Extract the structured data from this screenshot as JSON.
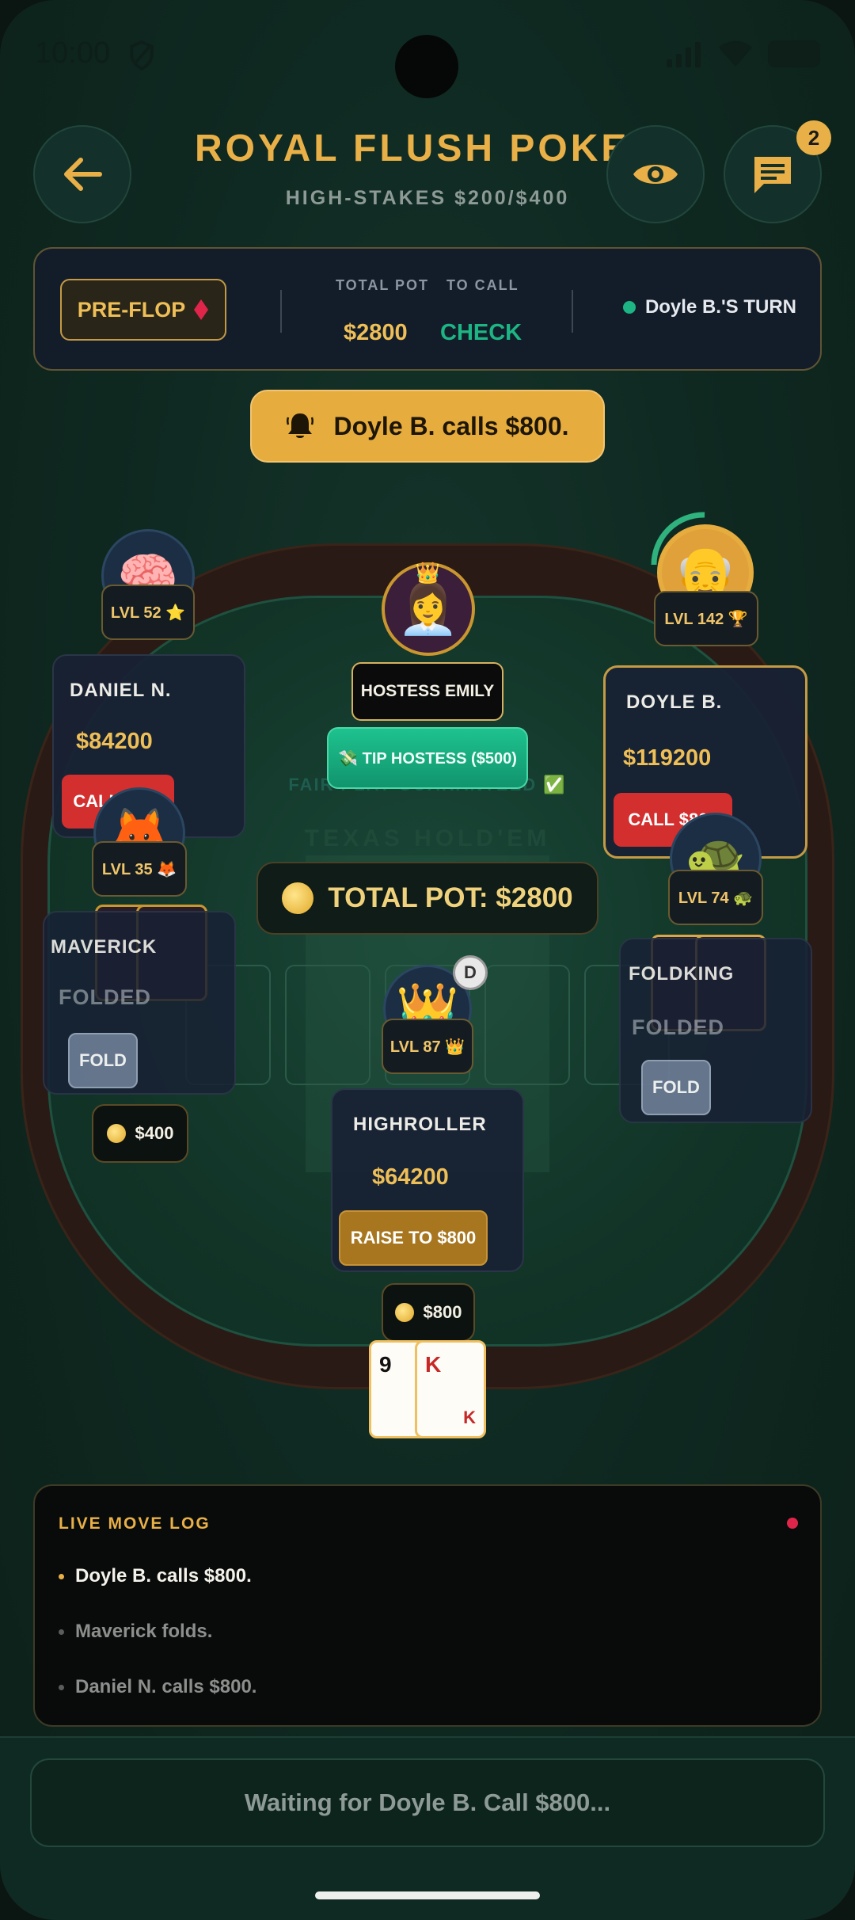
{
  "status_bar": {
    "time": "10:00"
  },
  "header": {
    "title": "ROYAL FLUSH POKER",
    "subtitle": "HIGH-STAKES $200/$400",
    "chat_badge": "2"
  },
  "game_status": {
    "phase": "PRE-FLOP",
    "total_pot_label": "TOTAL POT",
    "total_pot": "$2800",
    "to_call_label": "TO CALL",
    "to_call": "CHECK",
    "turn": "Doyle B.'S TURN"
  },
  "toast": "Doyle B. calls $800.",
  "table": {
    "fair_play": "FAIR PLAY GUARANTEED ✅",
    "game_name": "TEXAS HOLD'EM",
    "pot": "TOTAL POT: $2800",
    "dealer": "D"
  },
  "hostess": {
    "name": "HOSTESS EMILY",
    "tip": "💸 TIP HOSTESS ($500)"
  },
  "players": {
    "daniel": {
      "name": "DANIEL N.",
      "chips": "$84200",
      "action": "CALL $800",
      "level": "LVL 52 ⭐",
      "avatar": "🧠"
    },
    "doyle": {
      "name": "DOYLE B.",
      "chips": "$119200",
      "action": "CALL $800",
      "level": "LVL 142 🏆",
      "avatar": "👴",
      "timer": 0.25
    },
    "maverick": {
      "name": "MAVERICK",
      "status": "FOLDED",
      "action": "FOLD",
      "level": "LVL 35 🦊",
      "avatar": "🦊",
      "bet": "$400"
    },
    "foldking": {
      "name": "FOLDKING",
      "status": "FOLDED",
      "action": "FOLD",
      "level": "LVL 74 🐢",
      "avatar": "🐢"
    },
    "highroller": {
      "name": "HIGHROLLER",
      "chips": "$64200",
      "action": "RAISE TO $800",
      "level": "LVL 87 👑",
      "avatar": "👑",
      "bet": "$800"
    }
  },
  "hero_cards": [
    {
      "rank": "9",
      "color": "#111111"
    },
    {
      "rank": "K",
      "suit": "K",
      "color": "#c62828"
    }
  ],
  "log": {
    "title": "LIVE MOVE LOG",
    "items": [
      "Doyle B. calls $800.",
      "Maverick folds.",
      "Daniel N. calls $800."
    ]
  },
  "footer": {
    "waiting": "Waiting for Doyle B. Call $800..."
  },
  "colors": {
    "accent": "#e9b048",
    "felt": "#123528",
    "call": "#d32f2f",
    "raise": "#a8761f",
    "check": "#1db583"
  }
}
